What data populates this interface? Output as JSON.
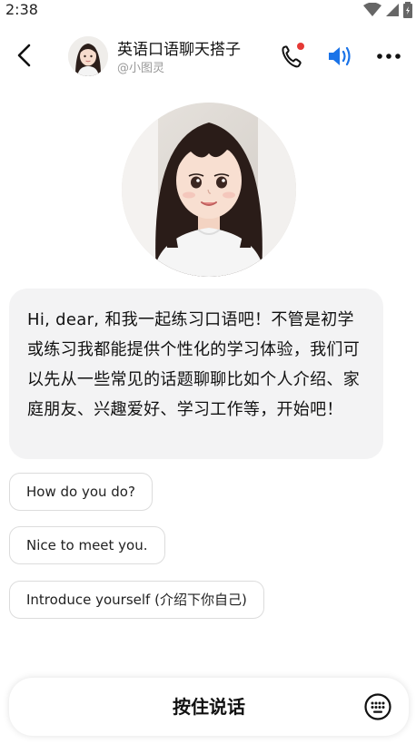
{
  "status_bar": {
    "time": "2:38"
  },
  "header": {
    "title": "英语口语聊天搭子",
    "handle": "@小图灵",
    "call_indicator_color": "#e53935",
    "speaker_color": "#1a73e8"
  },
  "message": {
    "text": "Hi, dear, 和我一起练习口语吧！不管是初学或练习我都能提供个性化的学习体验，我们可以先从一些常见的话题聊聊比如个人介绍、家庭朋友、兴趣爱好、学习工作等，开始吧！"
  },
  "suggestions": [
    {
      "label": "How do you do?"
    },
    {
      "label": "Nice to meet you."
    },
    {
      "label": "Introduce yourself (介绍下你自己)"
    }
  ],
  "input_bar": {
    "hold_to_talk_label": "按住说话"
  },
  "icons": {
    "back": "chevron-left-icon",
    "phone": "phone-icon",
    "speaker": "speaker-icon",
    "more": "more-dots-icon",
    "keyboard": "keyboard-icon"
  }
}
